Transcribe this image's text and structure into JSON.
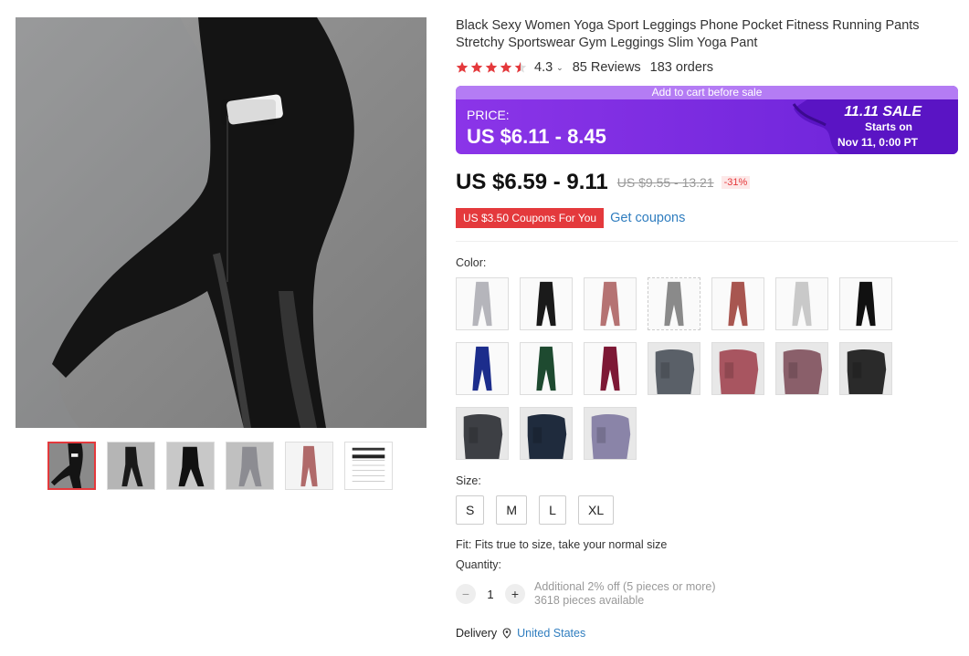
{
  "product": {
    "title": "Black Sexy Women Yoga Sport Leggings Phone Pocket Fitness Running Pants Stretchy Sportswear Gym Leggings Slim Yoga Pant",
    "rating": "4.3",
    "rating_stars": 4.3,
    "reviews": "85 Reviews",
    "orders": "183 orders"
  },
  "promo": {
    "banner_top": "Add to cart before sale",
    "price_label": "PRICE:",
    "price": "US $6.11 - 8.45",
    "sale_name": "11.11 SALE",
    "starts_on": "Starts on",
    "start_date": "Nov 11, 0:00 PT"
  },
  "pricing": {
    "current": "US $6.59 - 9.11",
    "original": "US $9.55 - 13.21",
    "discount": "-31%"
  },
  "coupons": {
    "badge": "US $3.50 Coupons For You",
    "link": "Get coupons"
  },
  "options": {
    "color_label": "Color:",
    "colors": [
      {
        "name": "light-gray",
        "hex": "#b5b5bb"
      },
      {
        "name": "black",
        "hex": "#1a1a1a"
      },
      {
        "name": "rose",
        "hex": "#b57373"
      },
      {
        "name": "gray",
        "hex": "#8a8a8a"
      },
      {
        "name": "red-brown",
        "hex": "#a85650"
      },
      {
        "name": "silver",
        "hex": "#c9c9c9"
      },
      {
        "name": "black-mesh",
        "hex": "#111111"
      },
      {
        "name": "blue",
        "hex": "#1c2d8c"
      },
      {
        "name": "green",
        "hex": "#1e4a30"
      },
      {
        "name": "wine",
        "hex": "#7d1835"
      },
      {
        "name": "slate",
        "hex": "#5a6068"
      },
      {
        "name": "pink-pocket",
        "hex": "#a85560"
      },
      {
        "name": "mauve-pocket",
        "hex": "#8a5f6a"
      },
      {
        "name": "black-pocket",
        "hex": "#2a2a2a"
      },
      {
        "name": "charcoal",
        "hex": "#3d3f44"
      },
      {
        "name": "navy-pocket",
        "hex": "#1f2b3d"
      },
      {
        "name": "lavender",
        "hex": "#8a84a8"
      }
    ],
    "size_label": "Size:",
    "sizes": [
      "S",
      "M",
      "L",
      "XL"
    ],
    "fit": "Fit: Fits true to size, take your normal size",
    "quantity_label": "Quantity:",
    "quantity": "1",
    "quantity_note_1": "Additional 2% off (5 pieces or more)",
    "quantity_note_2": "3618 pieces available"
  },
  "delivery": {
    "label": "Delivery",
    "country": "United States"
  },
  "theme": {
    "accent_red": "#e4393c",
    "promo_purple": "#7a2ee0",
    "link_blue": "#2f7dbf"
  }
}
